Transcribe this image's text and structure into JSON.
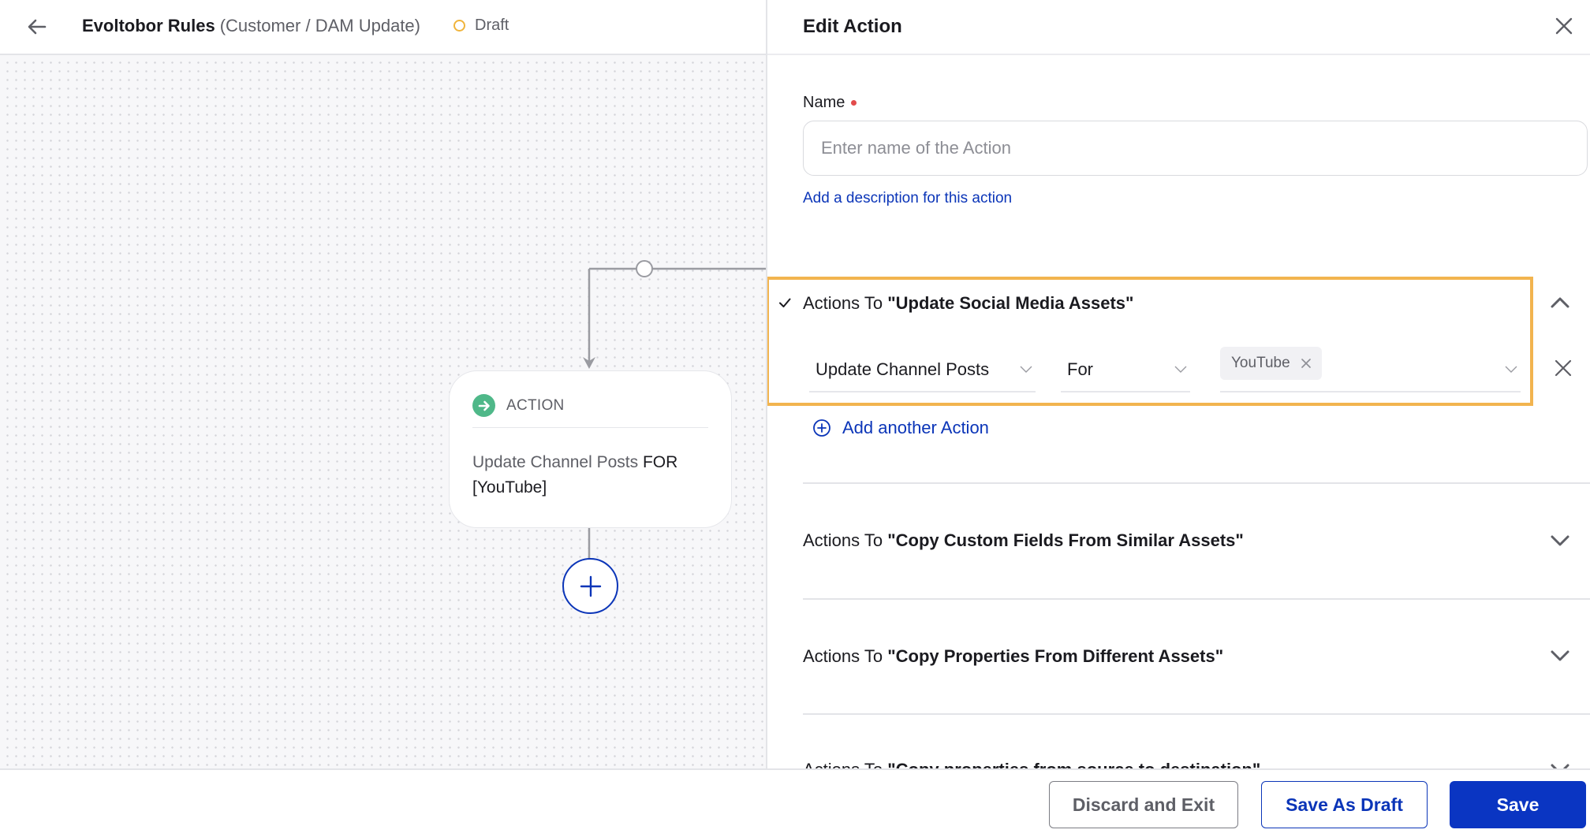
{
  "header": {
    "title": "Evoltobor Rules",
    "subtitle": "(Customer / DAM Update)",
    "status": "Draft",
    "status_color": "#f0b43c"
  },
  "canvas": {
    "node": {
      "type_label": "ACTION",
      "icon": "arrow-right-circle-icon",
      "icon_color": "#4fb889",
      "action_text": "Update Channel Posts",
      "keyword": "FOR",
      "target_text": "[YouTube]"
    },
    "add_node_icon": "plus-icon"
  },
  "panel": {
    "title": "Edit Action",
    "name_label": "Name",
    "name_value": "",
    "name_placeholder": "Enter name of the Action",
    "description_link": "Add a description for this action",
    "sections": [
      {
        "prefix": "Actions To ",
        "name": "\"Update Social Media Assets\"",
        "expanded": true,
        "completed": true,
        "rows": [
          {
            "action": "Update Channel Posts",
            "operator": "For",
            "values": [
              "YouTube"
            ]
          }
        ],
        "add_label": "Add another Action"
      },
      {
        "prefix": "Actions To ",
        "name": "\"Copy Custom Fields From Similar Assets\"",
        "expanded": false
      },
      {
        "prefix": "Actions To ",
        "name": "\"Copy Properties From Different Assets\"",
        "expanded": false
      },
      {
        "prefix": "Actions To ",
        "name": "\"Copy properties from source to destination\"",
        "expanded": false
      }
    ],
    "highlight_color": "#f2b44f"
  },
  "footer": {
    "discard_label": "Discard and Exit",
    "draft_label": "Save As Draft",
    "save_label": "Save",
    "primary_color": "#0a35c2"
  }
}
